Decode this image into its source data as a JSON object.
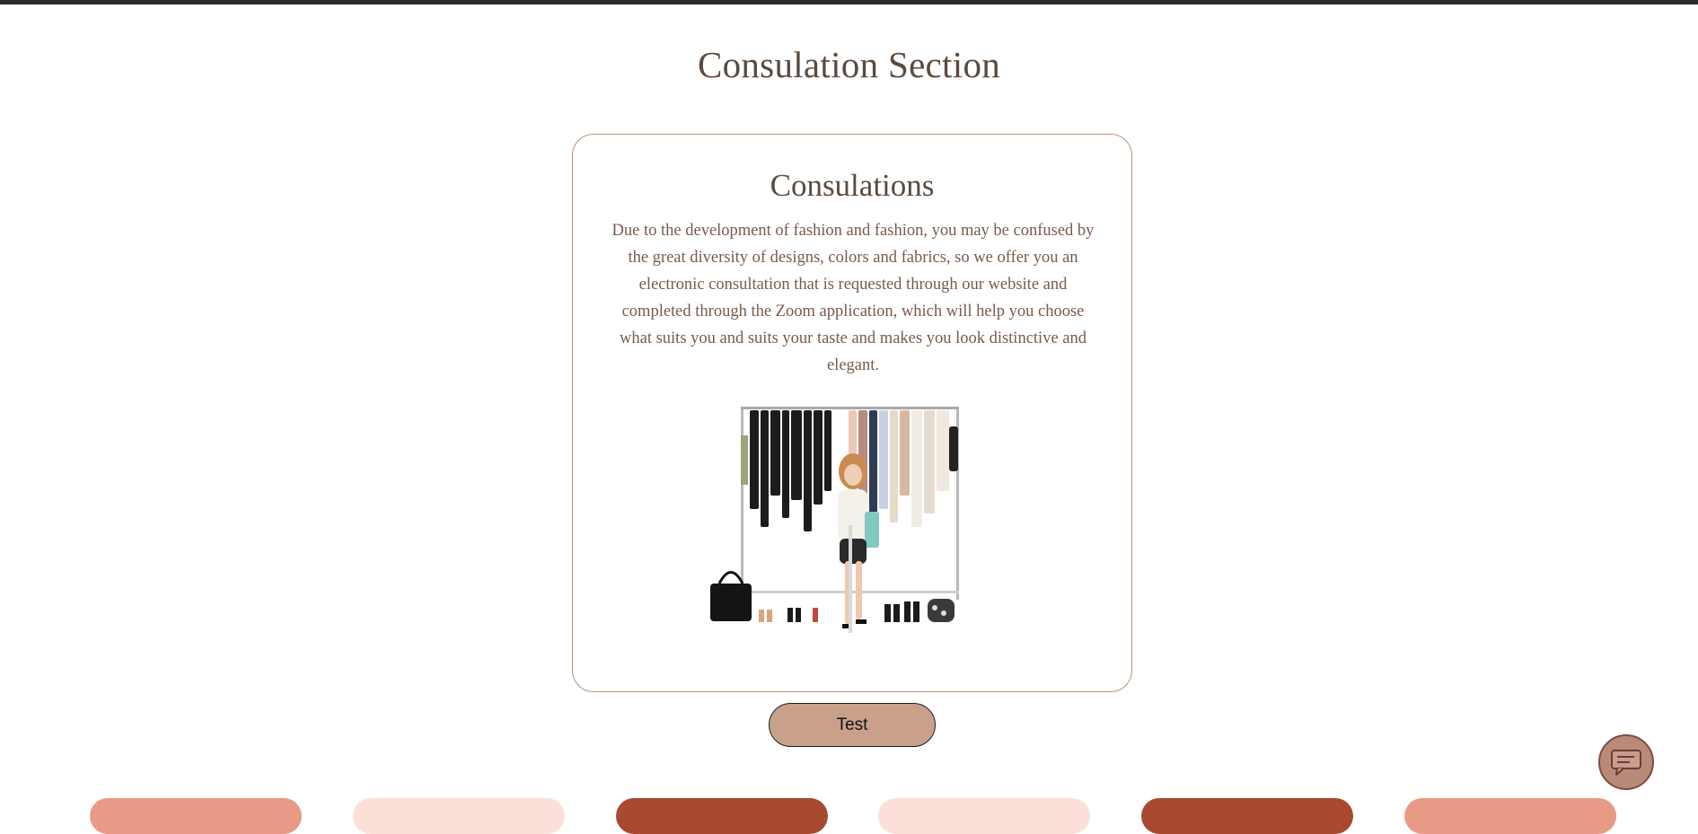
{
  "page": {
    "section_title": "Consulation Section"
  },
  "card": {
    "title": "Consulations",
    "description": "Due to the development of fashion and fashion, you may be confused by the great diversity of designs, colors and fabrics, so we offer you an electronic consultation that is requested through our website and completed through the Zoom application, which will help you choose what suits you and suits your taste and makes you look distinctive and elegant.",
    "image_icon": "wardrobe-photo"
  },
  "actions": {
    "test_label": "Test"
  },
  "chat": {
    "icon": "chat-bubble-icon"
  },
  "tiles": {
    "colors": [
      "#e89a86",
      "#fbe0d9",
      "#a84a30",
      "#fbe0d9",
      "#a84a30",
      "#e89a86"
    ]
  },
  "theme": {
    "accent": "#c9a18a",
    "border": "#b9917a",
    "heading": "#5c4a3e",
    "text": "#7a5a4c"
  }
}
